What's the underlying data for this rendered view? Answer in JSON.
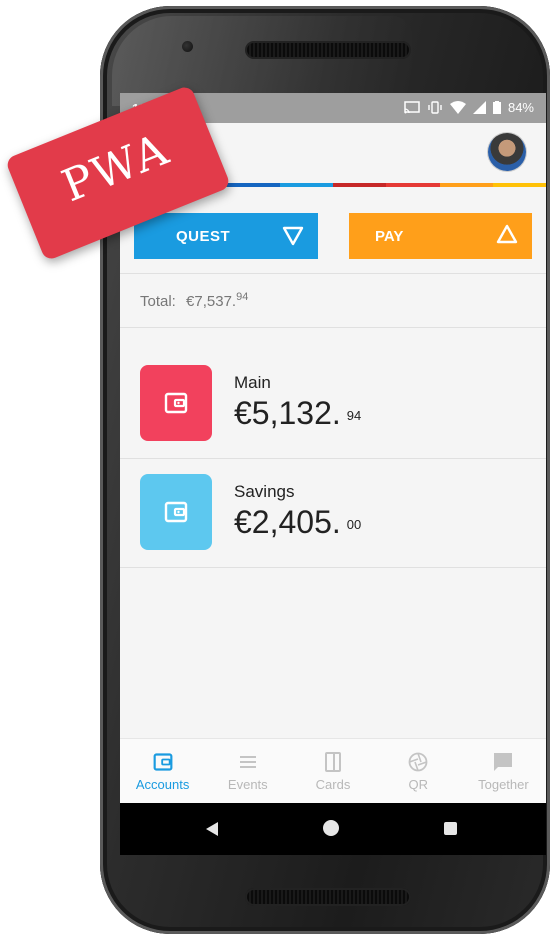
{
  "colors": {
    "accent": "#1a9be0",
    "pay": "#ff9f1a",
    "main_tile": "#f2415d",
    "savings_tile": "#5dc8ef",
    "sticker": "#e23b4a",
    "stripe": [
      "#1a9be0",
      "#4caf50",
      "#1565c0",
      "#1a9be0",
      "#c62828",
      "#e53935",
      "#ff9f1a",
      "#ffc107"
    ]
  },
  "status_bar": {
    "time": "11:0",
    "battery": "84%",
    "icons": [
      "cast-icon",
      "vibrate-icon",
      "wifi-icon",
      "signal-icon",
      "battery-icon"
    ]
  },
  "appbar": {
    "title": "ts"
  },
  "actions": {
    "request_label": "QUEST",
    "pay_label": "PAY"
  },
  "total": {
    "label": "Total:",
    "amount": "€7,537.",
    "cents": "94"
  },
  "accounts": [
    {
      "name": "Main",
      "amount": "€5,132.",
      "cents": "94",
      "icon": "wallet-icon"
    },
    {
      "name": "Savings",
      "amount": "€2,405.",
      "cents": "00",
      "icon": "wallet-icon"
    }
  ],
  "bottom_nav": [
    {
      "label": "Accounts",
      "icon": "wallet-icon",
      "active": true
    },
    {
      "label": "Events",
      "icon": "list-icon",
      "active": false
    },
    {
      "label": "Cards",
      "icon": "card-icon",
      "active": false
    },
    {
      "label": "QR",
      "icon": "aperture-icon",
      "active": false
    },
    {
      "label": "Together",
      "icon": "chat-icon",
      "active": false
    }
  ],
  "sticker": {
    "text": "PWA"
  }
}
